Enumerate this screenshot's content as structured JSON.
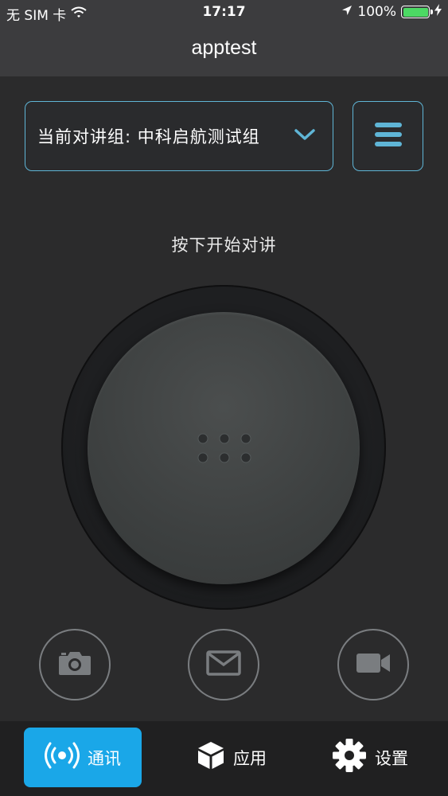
{
  "status_bar": {
    "carrier": "无 SIM 卡",
    "time": "17:17",
    "battery": "100%",
    "battery_level": 1.0
  },
  "nav": {
    "title": "apptest"
  },
  "group_selector": {
    "label": "当前对讲组: 中科启航测试组",
    "icon": "chevron-down-icon"
  },
  "menu_button": {
    "icon": "hamburger-menu-icon"
  },
  "talk": {
    "hint": "按下开始对讲",
    "icon": "grip-dots-icon"
  },
  "actions": [
    {
      "name": "camera",
      "icon": "camera-icon"
    },
    {
      "name": "message",
      "icon": "envelope-icon"
    },
    {
      "name": "video",
      "icon": "video-camera-icon"
    }
  ],
  "tabs": [
    {
      "label": "通讯",
      "icon": "broadcast-icon",
      "active": true
    },
    {
      "label": "应用",
      "icon": "cube-icon",
      "active": false
    },
    {
      "label": "设置",
      "icon": "gear-icon",
      "active": false
    }
  ],
  "colors": {
    "accent": "#5fb5d6",
    "active_tab": "#1aa7e8",
    "background": "#2b2b2c",
    "nav_bar": "#3c3c3e",
    "battery": "#4cd964"
  }
}
